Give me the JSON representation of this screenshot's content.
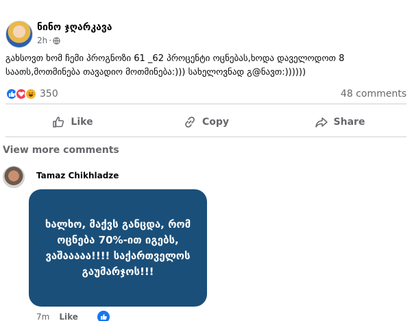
{
  "post": {
    "author": "ნინო ჯღარკავა",
    "time": "2h",
    "meta_separator": "·",
    "text": "გახსოვთ ხომ ჩემი პროგნოზი 61 _62 პროცენტი ოცნებას,ხოდა დაველოდოთ 8 საათს,მოთმინება თავადიო მოთმინება:))) სახელოვნად გ@ნავთ:))))))"
  },
  "stats": {
    "reaction_count": "350",
    "comment_count": "48 comments",
    "reactions": [
      "like",
      "love",
      "haha"
    ]
  },
  "actions": {
    "like_label": "Like",
    "copy_label": "Copy",
    "share_label": "Share"
  },
  "comments": {
    "view_more": "View more comments",
    "first": {
      "author": "Tamaz Chikhladze",
      "sticker_text": "ხალხო, მაქვს განცდა, რომ ოცნება 70%-ით იგებს, ვაშააააა!!!! საქართველოს გაუმარჯოს!!!",
      "time": "7m",
      "like_label": "Like"
    }
  },
  "colors": {
    "accent": "#1877f2",
    "love": "#f33e58",
    "haha": "#f7b125",
    "sticker_bg": "#1a4f7a",
    "muted_text": "#65676b"
  },
  "icons": [
    "globe-icon",
    "like-icon",
    "copy-icon",
    "share-icon",
    "like-reaction-icon",
    "love-reaction-icon",
    "haha-reaction-icon"
  ]
}
